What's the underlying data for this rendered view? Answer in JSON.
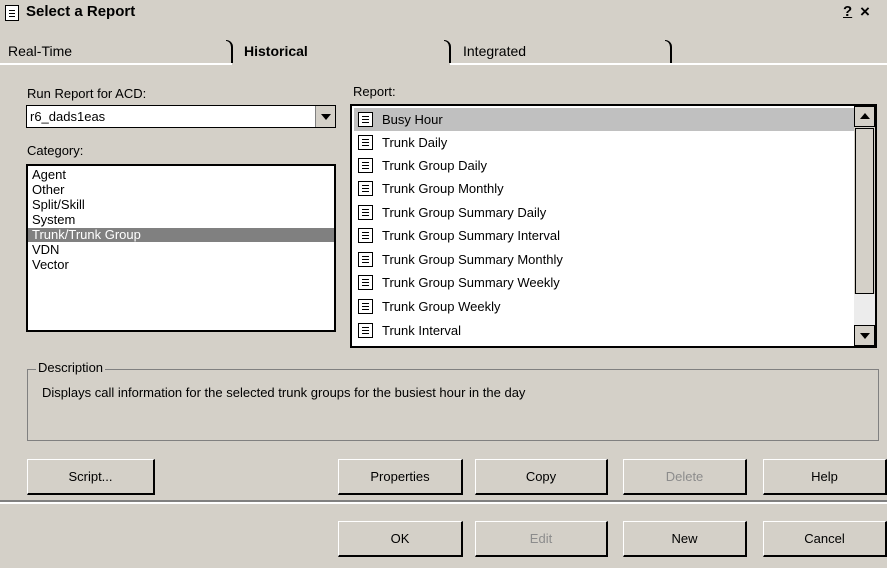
{
  "window": {
    "title": "Select a Report",
    "help_glyph": "?",
    "close_glyph": "×"
  },
  "tabs": [
    {
      "label": "Real-Time",
      "active": false
    },
    {
      "label": "Historical",
      "active": true
    },
    {
      "label": "Integrated",
      "active": false
    }
  ],
  "acd": {
    "label": "Run Report for ACD:",
    "value": "r6_dads1eas"
  },
  "category": {
    "label": "Category:",
    "items": [
      "Agent",
      "Other",
      "Split/Skill",
      "System",
      "Trunk/Trunk Group",
      "VDN",
      "Vector"
    ],
    "selected": "Trunk/Trunk Group"
  },
  "report": {
    "label": "Report:",
    "items": [
      "Busy Hour",
      "Trunk Daily",
      "Trunk Group Daily",
      "Trunk Group Monthly",
      "Trunk Group Summary Daily",
      "Trunk Group Summary Interval",
      "Trunk Group Summary Monthly",
      "Trunk Group Summary Weekly",
      "Trunk Group Weekly",
      "Trunk Interval"
    ],
    "selected": "Busy Hour"
  },
  "description": {
    "legend": "Description",
    "text": "Displays call information for the selected trunk groups for the busiest hour in the day"
  },
  "buttons_row1": {
    "script": "Script...",
    "properties": "Properties",
    "copy": "Copy",
    "delete": "Delete",
    "help": "Help"
  },
  "buttons_row2": {
    "ok": "OK",
    "edit": "Edit",
    "new": "New",
    "cancel": "Cancel"
  },
  "colors": {
    "face": "#d4d0c8",
    "selection_category": "#808080",
    "selection_report": "#c0c0c0",
    "disabled_text": "#8c8c8c"
  }
}
